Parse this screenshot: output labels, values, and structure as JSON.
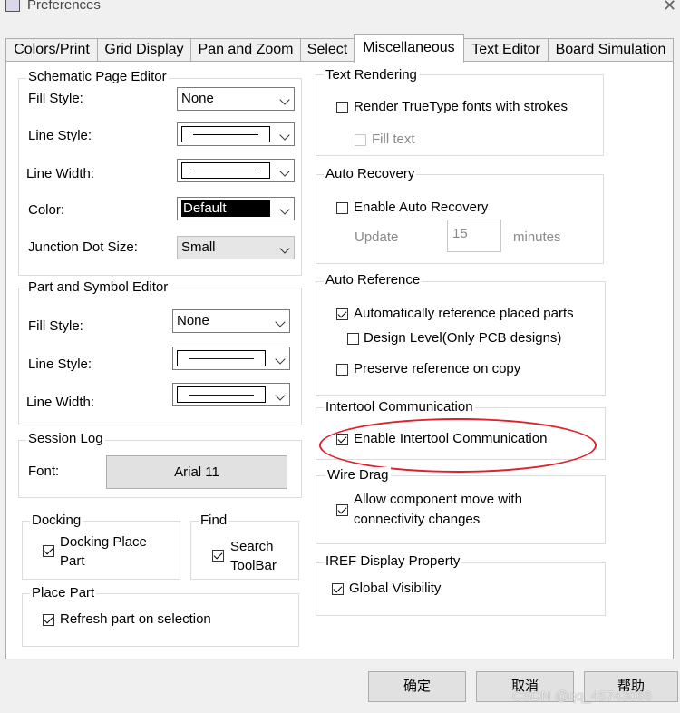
{
  "window": {
    "title": "Preferences"
  },
  "tabs": [
    "Colors/Print",
    "Grid Display",
    "Pan and Zoom",
    "Select",
    "Miscellaneous",
    "Text Editor",
    "Board Simulation"
  ],
  "schematic": {
    "title": "Schematic Page Editor",
    "fill_style_label": "Fill Style:",
    "fill_style_value": "None",
    "line_style_label": "Line Style:",
    "line_width_label": "Line Width:",
    "color_label": "Color:",
    "color_value": "Default",
    "junction_label": "Junction Dot Size:",
    "junction_value": "Small"
  },
  "part_symbol": {
    "title": "Part and Symbol Editor",
    "fill_style_label": "Fill Style:",
    "fill_style_value": "None",
    "line_style_label": "Line Style:",
    "line_width_label": "Line Width:"
  },
  "session_log": {
    "title": "Session Log",
    "font_label": "Font:",
    "font_button": "Arial 11"
  },
  "docking": {
    "title": "Docking",
    "option_line1": "Docking Place",
    "option_line2": "Part",
    "checked": true
  },
  "find": {
    "title": "Find",
    "option_line1": "Search",
    "option_line2": "ToolBar",
    "checked": true
  },
  "place_part": {
    "title": "Place Part",
    "option": "Refresh part on selection",
    "checked": true
  },
  "text_rendering": {
    "title": "Text Rendering",
    "option": "Render TrueType fonts with strokes",
    "sub_option": "Fill text"
  },
  "auto_recovery": {
    "title": "Auto Recovery",
    "option": "Enable Auto Recovery",
    "update_label": "Update",
    "update_value": "15",
    "unit": "minutes"
  },
  "auto_reference": {
    "title": "Auto Reference",
    "option1": "Automatically reference placed parts",
    "option2": "Design Level(Only PCB designs)",
    "option3": "Preserve reference on copy"
  },
  "intertool": {
    "title": "Intertool Communication",
    "option": "Enable Intertool Communication"
  },
  "wire_drag": {
    "title": "Wire Drag",
    "option_line1": "Allow component move with",
    "option_line2": "connectivity changes"
  },
  "iref": {
    "title": "IREF Display Property",
    "option": "Global Visibility"
  },
  "buttons": {
    "ok": "确定",
    "cancel": "取消",
    "help": "帮助"
  },
  "watermark": "CSDN @qq_45743066",
  "colors": {
    "highlight_ellipse": "#e0202a",
    "line_style_blue": "#0000cc"
  }
}
